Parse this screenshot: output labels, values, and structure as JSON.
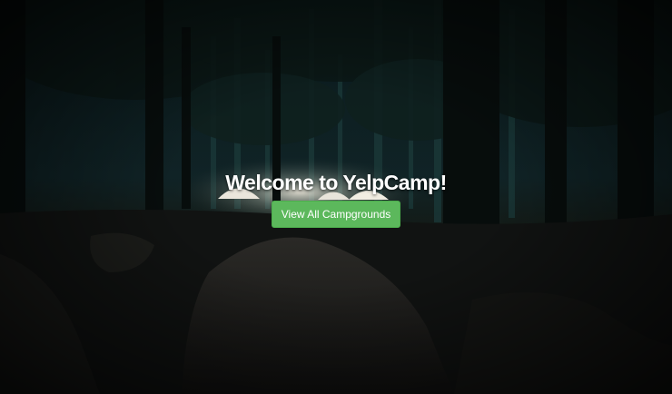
{
  "landing": {
    "title": "Welcome to YelpCamp!",
    "cta_label": "View All Campgrounds"
  },
  "background": {
    "scene": "night-forest-campsite",
    "colors": {
      "sky": "#0d1c1e",
      "trees": "#08110f",
      "tent_glow": "#f2ece0",
      "ground": "#151716"
    }
  },
  "colors": {
    "accent": "#5cb85c",
    "text": "#ffffff"
  }
}
